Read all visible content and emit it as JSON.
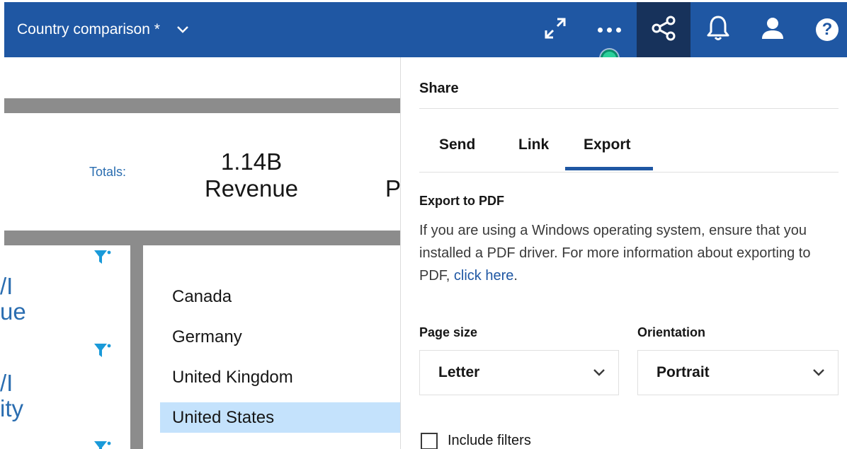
{
  "header": {
    "title": "Country comparison *",
    "icons": [
      "chevron-down-icon",
      "expand-icon",
      "more-options-icon",
      "share-icon",
      "notification-bell-icon",
      "user-profile-icon",
      "help-icon"
    ],
    "help_glyph": "?"
  },
  "dashboard": {
    "totals_label": "Totals:",
    "kpi_value": "1.14B",
    "kpi_label": "Revenue",
    "kpi_next_fragment": "P",
    "left_fragments": [
      {
        "line1": "/I",
        "line2": "ue"
      },
      {
        "line1": "/I",
        "line2": "ity"
      }
    ],
    "countries": [
      "Canada",
      "Germany",
      "United Kingdom",
      "United States"
    ],
    "selected_country": "United States"
  },
  "share_panel": {
    "title": "Share",
    "tabs": [
      {
        "label": "Send",
        "active": false
      },
      {
        "label": "Link",
        "active": false
      },
      {
        "label": "Export",
        "active": true
      }
    ],
    "section_title": "Export to PDF",
    "body_text": "If you are using a Windows operating system, ensure that you installed a PDF driver. For more information about exporting to PDF, ",
    "link_text": "click here",
    "body_end": ".",
    "page_size_label": "Page size",
    "page_size_value": "Letter",
    "orientation_label": "Orientation",
    "orientation_value": "Portrait",
    "include_filters_label": "Include filters",
    "include_filters_checked": false
  },
  "colors": {
    "header_bg": "#1f57a3",
    "active_icon_bg": "#17325b",
    "accent": "#1f57a3",
    "selected_row": "#c4e2fc",
    "filter_icon": "#1a9ad9"
  }
}
